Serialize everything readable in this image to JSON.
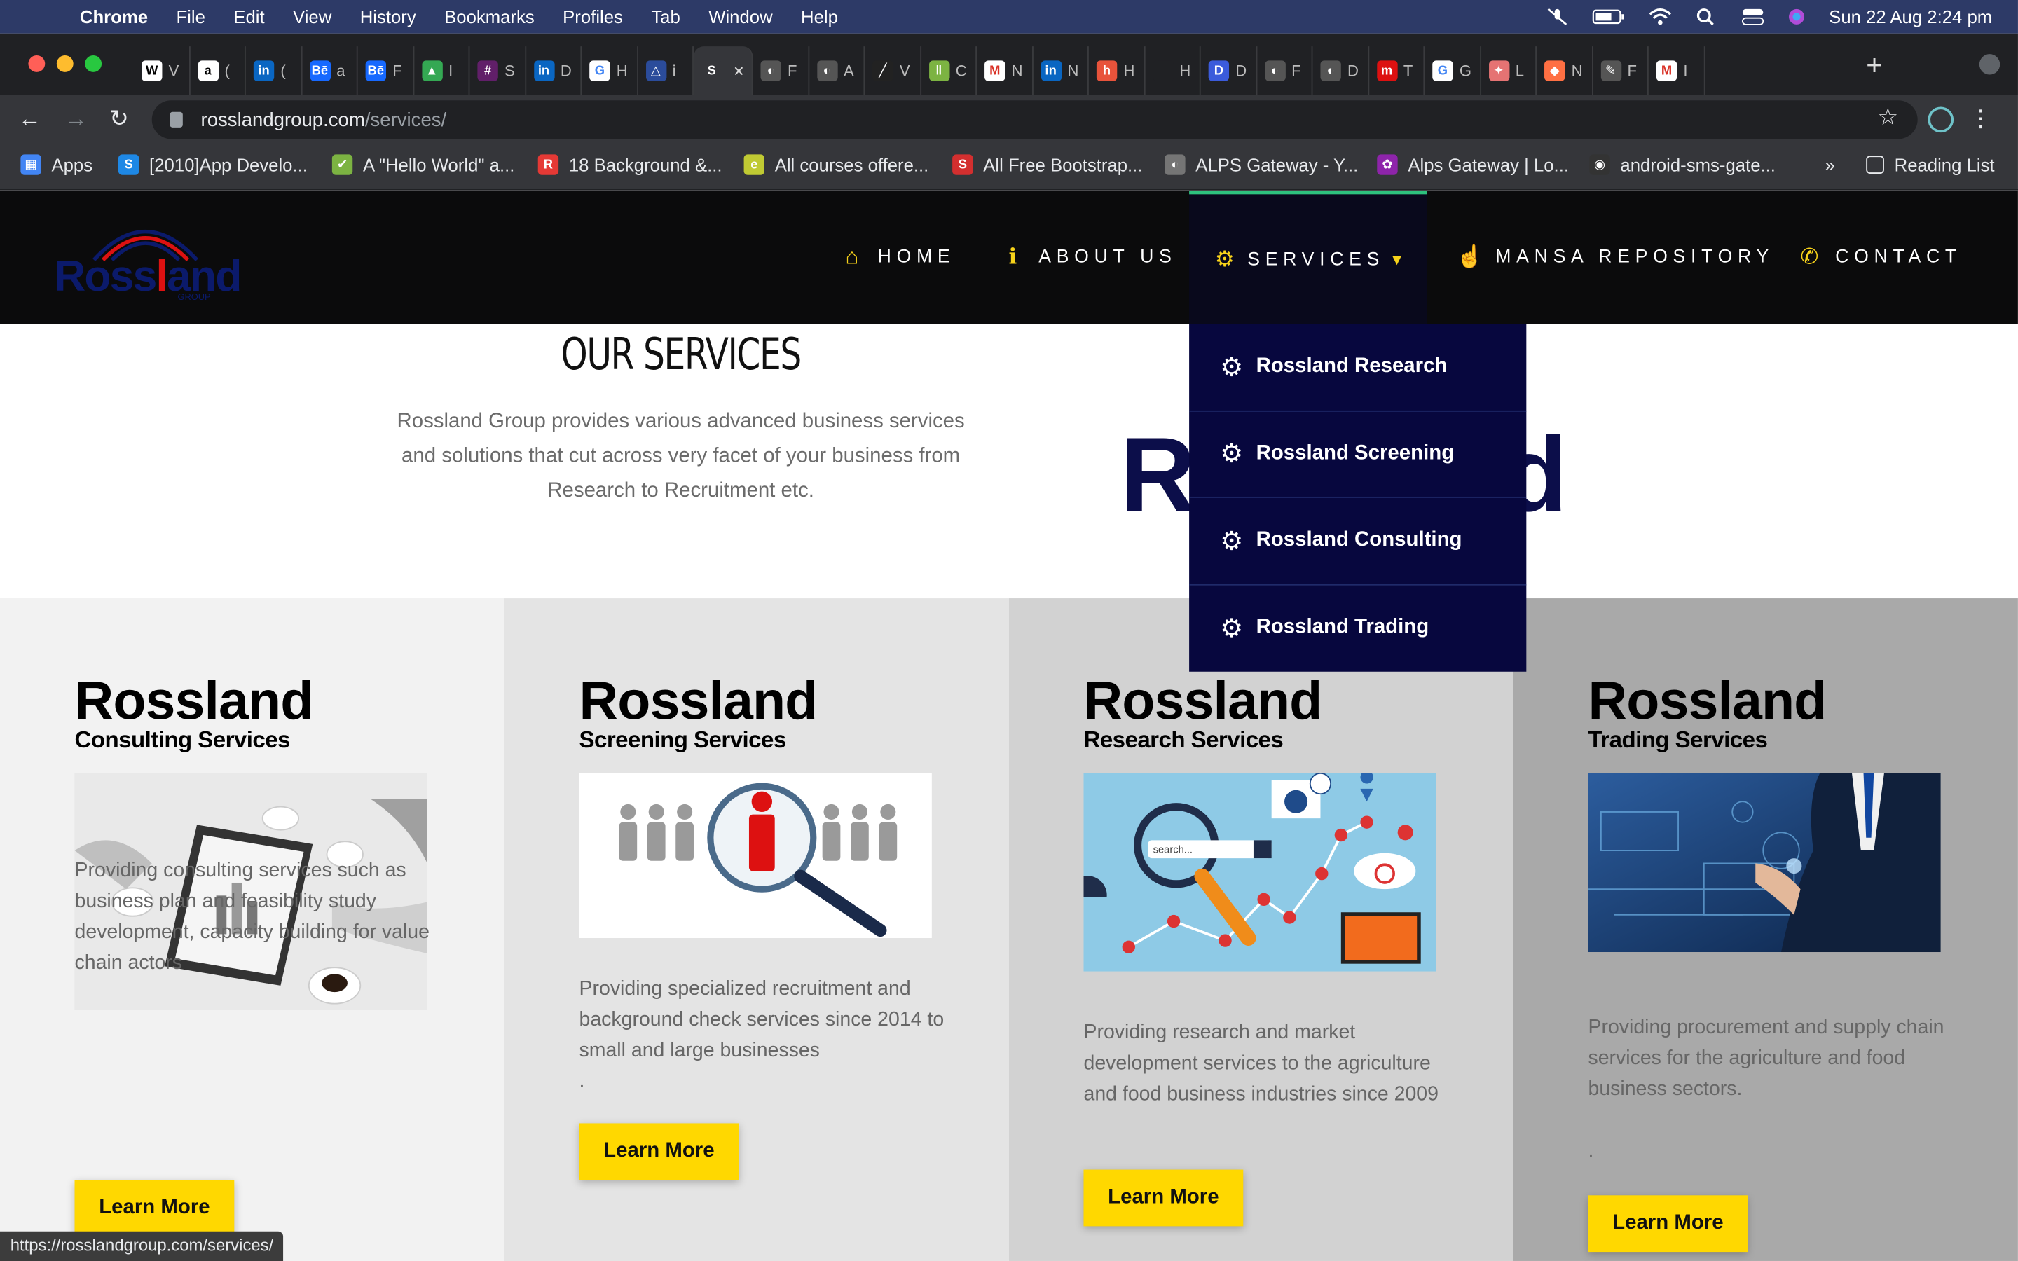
{
  "menubar": {
    "app": "Chrome",
    "items": [
      "File",
      "Edit",
      "View",
      "History",
      "Bookmarks",
      "Profiles",
      "Tab",
      "Window",
      "Help"
    ],
    "clock": "Sun 22 Aug  2:24 pm"
  },
  "tabs": [
    {
      "icon": "W",
      "color": "#ffffff",
      "text": "V",
      "fg": "#000"
    },
    {
      "icon": "a",
      "color": "#ffffff",
      "text": "(",
      "fg": "#000"
    },
    {
      "icon": "in",
      "color": "#0a66c2",
      "text": "("
    },
    {
      "icon": "Bē",
      "color": "#1769ff",
      "text": "a"
    },
    {
      "icon": "Bē",
      "color": "#1769ff",
      "text": "F"
    },
    {
      "icon": "▲",
      "color": "#34a853",
      "text": "I"
    },
    {
      "icon": "#",
      "color": "#611f69",
      "text": "S"
    },
    {
      "icon": "in",
      "color": "#0a66c2",
      "text": "D"
    },
    {
      "icon": "G",
      "color": "#ffffff",
      "text": "H",
      "fg": "#4285f4"
    },
    {
      "icon": "△",
      "color": "#2b4c9b",
      "text": "i"
    },
    {
      "icon": "S",
      "color": "#35363a",
      "text": "",
      "active": true
    },
    {
      "icon": "◐",
      "color": "#555",
      "text": "F"
    },
    {
      "icon": "◐",
      "color": "#555",
      "text": "A"
    },
    {
      "icon": "╱",
      "color": "#222",
      "text": "V"
    },
    {
      "icon": "ǁ",
      "color": "#7cb342",
      "text": "C"
    },
    {
      "icon": "M",
      "color": "#ffffff",
      "text": "N",
      "fg": "#d93025"
    },
    {
      "icon": "in",
      "color": "#0a66c2",
      "text": "N"
    },
    {
      "icon": "h",
      "color": "#e8533b",
      "text": "H"
    },
    {
      "icon": "",
      "color": "#202124",
      "text": "H"
    },
    {
      "icon": "D",
      "color": "#3b5bdb",
      "text": "D"
    },
    {
      "icon": "◐",
      "color": "#555",
      "text": "F"
    },
    {
      "icon": "◐",
      "color": "#555",
      "text": "D"
    },
    {
      "icon": "m",
      "color": "#d11",
      "text": "T"
    },
    {
      "icon": "G",
      "color": "#ffffff",
      "text": "G",
      "fg": "#4285f4"
    },
    {
      "icon": "✦",
      "color": "#e57373",
      "text": "L"
    },
    {
      "icon": "◆",
      "color": "#ff7043",
      "text": "N"
    },
    {
      "icon": "✎",
      "color": "#555",
      "text": "F"
    },
    {
      "icon": "M",
      "color": "#ffffff",
      "text": "I",
      "fg": "#d93025"
    }
  ],
  "toolbar": {
    "url_host": "rosslandgroup.com",
    "url_path": "/services/"
  },
  "bookmarks": [
    {
      "label": "Apps",
      "color": "#4285f4",
      "icon": "▦"
    },
    {
      "label": "[2010]App Develo...",
      "color": "#1e88e5",
      "icon": "S"
    },
    {
      "label": "A \"Hello World\" a...",
      "color": "#7cb342",
      "icon": "✔"
    },
    {
      "label": "18 Background &...",
      "color": "#e53935",
      "icon": "R"
    },
    {
      "label": "All courses offere...",
      "color": "#c0ca33",
      "icon": "e"
    },
    {
      "label": "All Free Bootstrap...",
      "color": "#d32f2f",
      "icon": "S"
    },
    {
      "label": "ALPS Gateway - Y...",
      "color": "#757575",
      "icon": "◐"
    },
    {
      "label": "Alps Gateway | Lo...",
      "color": "#8e24aa",
      "icon": "✿"
    },
    {
      "label": "android-sms-gate...",
      "color": "#333",
      "icon": "◉"
    }
  ],
  "bookmarks_more": "»",
  "reading_list": "Reading List",
  "site": {
    "logo_word_1": "Ross",
    "logo_word_red": "l",
    "logo_word_2": "and",
    "logo_small": "GROUP",
    "nav": [
      {
        "label": "HOME",
        "icon": "⌂"
      },
      {
        "label": "ABOUT US",
        "icon": "ℹ"
      },
      {
        "label": "SERVICES",
        "icon": "⚙"
      },
      {
        "label": "MANSA REPOSITORY",
        "icon": "☝"
      },
      {
        "label": "CONTACT",
        "icon": "✆"
      }
    ],
    "dropdown": [
      "Rossland Research",
      "Rossland Screening",
      "Rossland Consulting",
      "Rossland Trading"
    ],
    "section_title": "OUR SERVICES",
    "section_text": "Rossland Group provides various advanced business services and solutions that cut across very facet of your business from Research to Recruitment etc.",
    "big_word": "Rossland",
    "services": [
      {
        "title": "Rossland",
        "subtitle": "Consulting Services",
        "desc": "Providing consulting services such as business plan and feasibility study development, capacity building for value chain actors",
        "button": "Learn More",
        "bg": "#f2f2f2"
      },
      {
        "title": "Rossland",
        "subtitle": "Screening Services",
        "desc": "Providing specialized recruitment and background check services since 2014 to small and large businesses",
        "extra": ".",
        "button": "Learn More",
        "bg": "#e4e4e4"
      },
      {
        "title": "Rossland",
        "subtitle": "Research Services",
        "desc": "Providing research and market development services to the agriculture and food business industries since 2009",
        "button": "Learn More",
        "bg": "#d2d2d2"
      },
      {
        "title": "Rossland",
        "subtitle": "Trading Services",
        "desc": "Providing procurement and supply chain services for the agriculture and food business sectors.",
        "extra": ".",
        "button": "Learn More",
        "bg": "#a9a9a9"
      }
    ]
  },
  "status_url": "https://rosslandgroup.com/services/"
}
